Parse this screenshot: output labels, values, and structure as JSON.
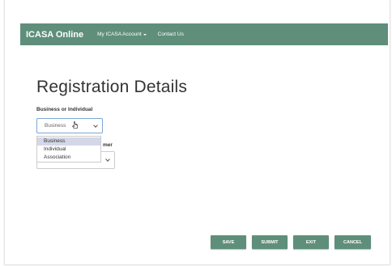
{
  "navbar": {
    "brand": "ICASA Online",
    "items": [
      {
        "label": "My ICASA Account"
      },
      {
        "label": "Contact Us"
      }
    ]
  },
  "page": {
    "title": "Registration Details",
    "business_label": "Business or Individual",
    "second_label_tail": "mer"
  },
  "business_select": {
    "value": "Business",
    "options": [
      "Business",
      "Individual",
      "Association"
    ],
    "highlighted": "Business"
  },
  "buttons": {
    "save": "SAVE",
    "submit": "SUBMIT",
    "exit": "EXIT",
    "cancel": "CANCEL"
  },
  "colors": {
    "navbar": "#5f8f7b",
    "buttons": "#5f8f7b",
    "select_focus_border": "#7aa7d6",
    "option_highlight": "#d4d7e8"
  }
}
